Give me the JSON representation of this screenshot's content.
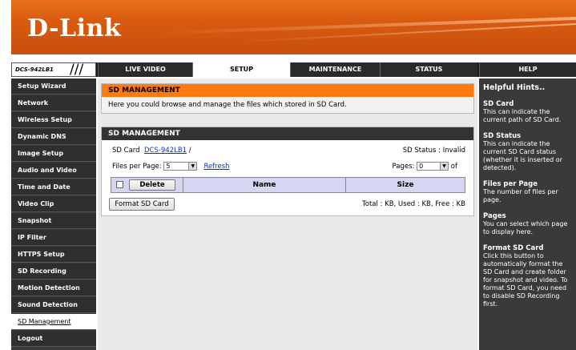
{
  "brand": {
    "logo_text": "D-Link"
  },
  "nav": {
    "model": "DCS-942LB1",
    "slashes": "///",
    "tabs": [
      "LIVE VIDEO",
      "SETUP",
      "MAINTENANCE",
      "STATUS",
      "HELP"
    ],
    "active_tab": "SETUP"
  },
  "sidebar": {
    "items": [
      "Setup Wizard",
      "Network",
      "Wireless Setup",
      "Dynamic DNS",
      "Image Setup",
      "Audio and Video",
      "Time and Date",
      "Video Clip",
      "Snapshot",
      "IP Filter",
      "HTTPS Setup",
      "SD Recording",
      "Motion Detection",
      "Sound Detection",
      "SD Management",
      "Logout"
    ],
    "active_item": "SD Management"
  },
  "main": {
    "header_box": {
      "title": "SD MANAGEMENT",
      "description": "Here you could browse and manage the files which stored in SD Card."
    },
    "sd_box": {
      "title": "SD MANAGEMENT",
      "sd_card_label": "SD Card",
      "sd_card_path_link": "DCS-942LB1",
      "sd_card_path_suffix": "/",
      "sd_status": "SD Status : Invalid",
      "files_per_page_label": "Files per Page:",
      "files_per_page_value": "5",
      "refresh_link": "Refresh",
      "pages_label": "Pages:",
      "pages_value": "0",
      "pages_of": "of",
      "table": {
        "delete_button": "Delete",
        "col_name": "Name",
        "col_size": "Size"
      },
      "format_button": "Format SD Card",
      "usage": "Total : KB,  Used : KB,  Free : KB"
    }
  },
  "hints": {
    "title": "Helpful Hints..",
    "sections": [
      {
        "head": "SD Card",
        "text": "This can indicate the current path of SD Card."
      },
      {
        "head": "SD Status",
        "text": "This can indicate the current SD Card status (whether it is inserted or detected)."
      },
      {
        "head": "Files per Page",
        "text": "The number of files per page."
      },
      {
        "head": "Pages",
        "text": "You can select which page to display here."
      },
      {
        "head": "Format SD Card",
        "text": "Click this button to automatically format the SD Card and create folder for snapshot and video. To format SD Card, you need to disable SD Recording first."
      }
    ]
  },
  "colors": {
    "accent_orange": "#ff7a10",
    "header_orange": "#d85a10",
    "dark_nav": "#2a2a2a",
    "table_header": "#d6d6f2"
  }
}
